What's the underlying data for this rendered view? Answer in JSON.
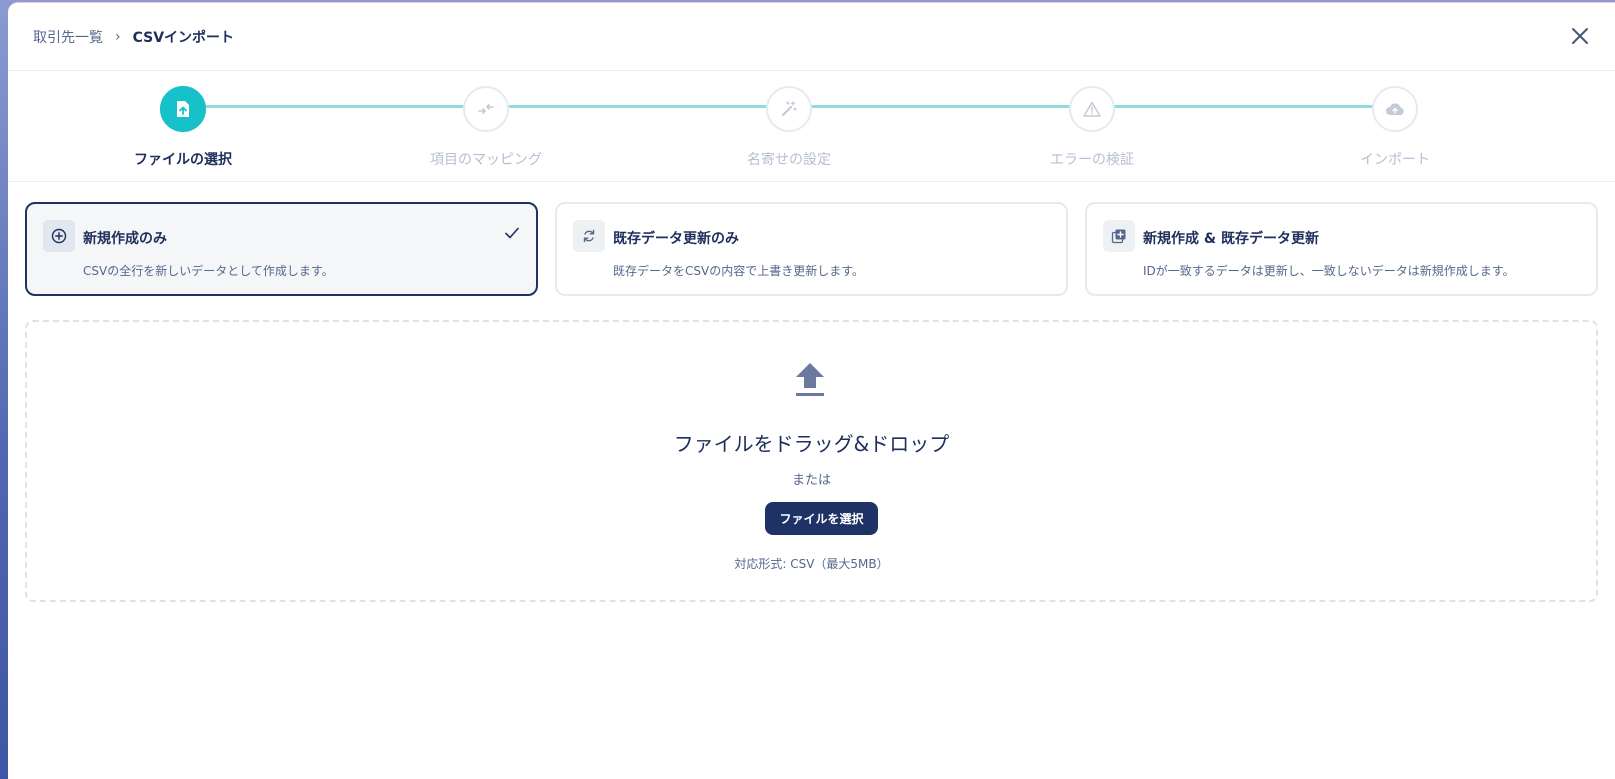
{
  "breadcrumb": {
    "parent": "取引先一覧",
    "separator": "›",
    "current": "CSVインポート"
  },
  "header": {
    "close_icon": "close-icon"
  },
  "stepper": {
    "steps": [
      {
        "label": "ファイルの選択",
        "icon": "file-upload-icon",
        "active": true
      },
      {
        "label": "項目のマッピング",
        "icon": "mapping-arrows-icon",
        "active": false
      },
      {
        "label": "名寄せの設定",
        "icon": "magic-wand-icon",
        "active": false
      },
      {
        "label": "エラーの検証",
        "icon": "warning-icon",
        "active": false
      },
      {
        "label": "インポート",
        "icon": "cloud-upload-icon",
        "active": false
      }
    ]
  },
  "modes": [
    {
      "title": "新規作成のみ",
      "description": "CSVの全行を新しいデータとして作成します。",
      "icon": "plus-circle-icon",
      "selected": true
    },
    {
      "title": "既存データ更新のみ",
      "description": "既存データをCSVの内容で上書き更新します。",
      "icon": "refresh-icon",
      "selected": false
    },
    {
      "title": "新規作成 & 既存データ更新",
      "description": "IDが一致するデータは更新し、一致しないデータは新規作成します。",
      "icon": "add-copy-icon",
      "selected": false
    }
  ],
  "dropzone": {
    "icon": "upload-icon",
    "title": "ファイルをドラッグ&ドロップ",
    "or_text": "または",
    "button_label": "ファイルを選択",
    "note": "対応形式: CSV（最大5MB）"
  },
  "colors": {
    "accent": "#16c1c9",
    "primary": "#1e3266",
    "step_line": "#8fdcdc"
  }
}
